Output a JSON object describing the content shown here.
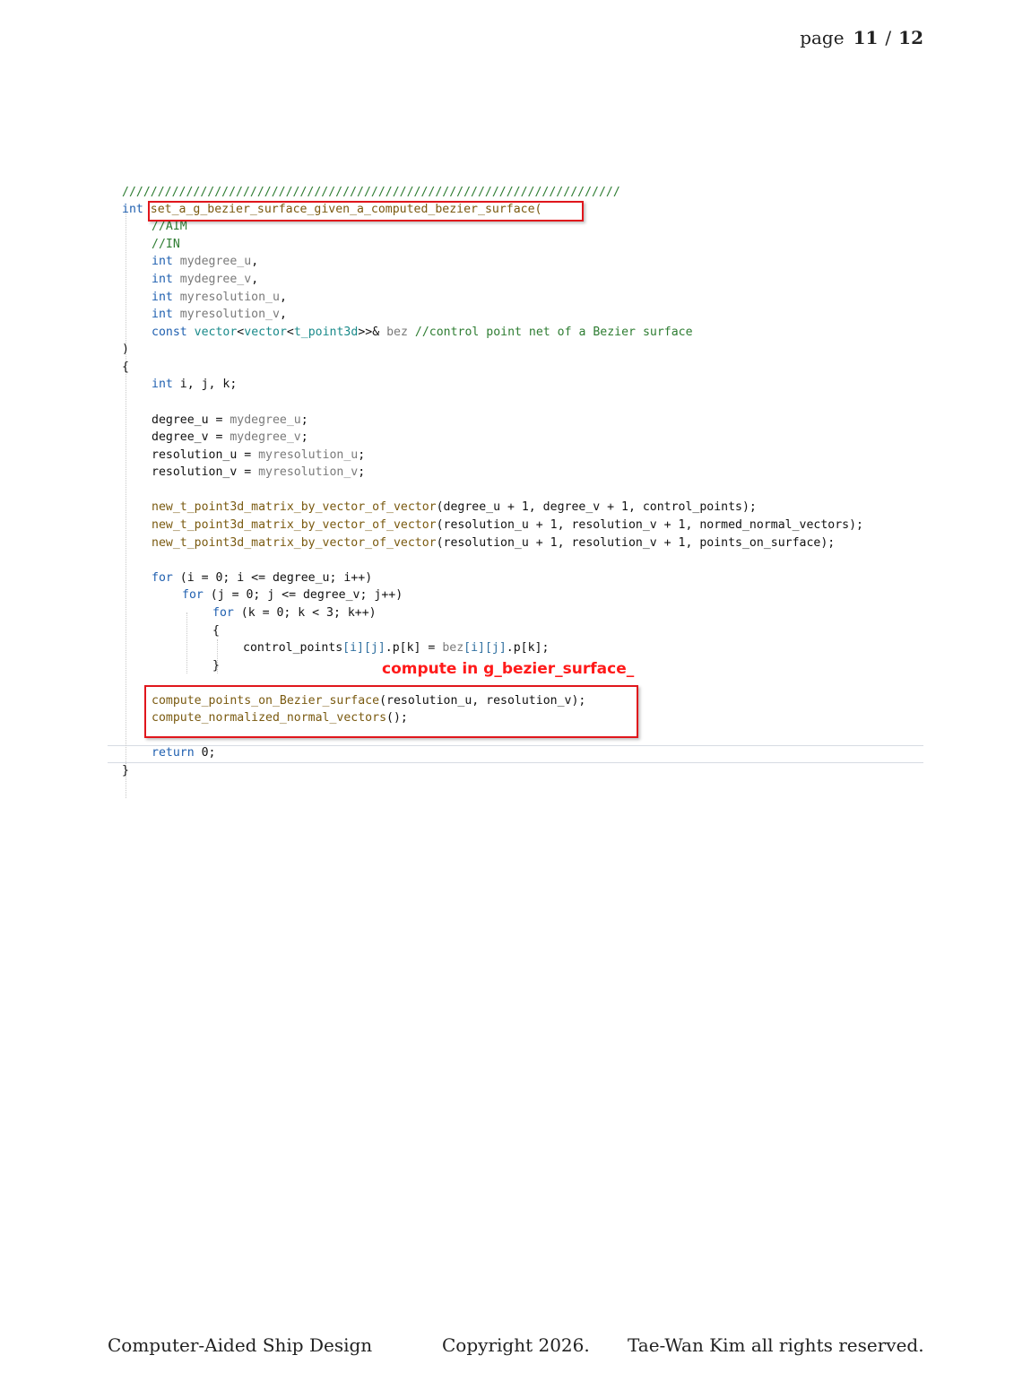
{
  "page_header": {
    "prefix": "page",
    "current": "11",
    "separator": "/",
    "total": "12"
  },
  "code": {
    "banner": "//////////////////////////////////////////////////////////////////////",
    "sig_kw": "int",
    "sig_fn": "set_a_g_bezier_surface_given_a_computed_bezier_surface(",
    "c_aim": "//AIM",
    "c_in": "//IN",
    "params": [
      {
        "kw": "int",
        "name": "mydegree_u",
        "end": ","
      },
      {
        "kw": "int",
        "name": "mydegree_v",
        "end": ","
      },
      {
        "kw": "int",
        "name": "myresolution_u",
        "end": ","
      },
      {
        "kw": "int",
        "name": "myresolution_v",
        "end": ","
      }
    ],
    "p5_const": "const",
    "p5_vec1": "vector",
    "p5_lt1": "<",
    "p5_vec2": "vector",
    "p5_lt2": "<",
    "p5_type": "t_point3d",
    "p5_gt": ">>&",
    "p5_name": "bez",
    "p5_comment": "//control point net of a Bezier surface",
    "close_paren": ")",
    "open_brace": "{",
    "decl_kw": "int",
    "decl_rest": " i, j, k;",
    "assign": [
      {
        "lhs": "degree_u = ",
        "rhs": "mydegree_u",
        "end": ";"
      },
      {
        "lhs": "degree_v = ",
        "rhs": "mydegree_v",
        "end": ";"
      },
      {
        "lhs": "resolution_u = ",
        "rhs": "myresolution_u",
        "end": ";"
      },
      {
        "lhs": "resolution_v = ",
        "rhs": "myresolution_v",
        "end": ";"
      }
    ],
    "calls": [
      {
        "fn": "new_t_point3d_matrix_by_vector_of_vector",
        "args": "(degree_u + 1, degree_v + 1, control_points);"
      },
      {
        "fn": "new_t_point3d_matrix_by_vector_of_vector",
        "args": "(resolution_u + 1, resolution_v + 1, normed_normal_vectors);"
      },
      {
        "fn": "new_t_point3d_matrix_by_vector_of_vector",
        "args": "(resolution_u + 1, resolution_v + 1, points_on_surface);"
      }
    ],
    "for1_kw": "for",
    "for1_rest": " (i = 0; i <= degree_u; i++)",
    "for2_kw": "for",
    "for2_rest": " (j = 0; j <= degree_v; j++)",
    "for3_kw": "for",
    "for3_rest": " (k = 0; k < 3; k++)",
    "inner_open": "{",
    "body_lhs": "control_points",
    "body_idx1": "[i][j]",
    "body_mid": ".p[k] = ",
    "body_bez": "bez",
    "body_idx2": "[i][j]",
    "body_end": ".p[k];",
    "inner_close": "}",
    "compute1_fn": "compute_points_on_Bezier_surface",
    "compute1_args": "(resolution_u, resolution_v);",
    "compute2_fn": "compute_normalized_normal_vectors",
    "compute2_args": "();",
    "ret_kw": "return",
    "ret_rest": " 0;",
    "close_brace": "}"
  },
  "annotation": "compute in g_bezier_surface_",
  "footer": {
    "left": "Computer-Aided Ship Design",
    "center": "Copyright 2026.",
    "right": "Tae-Wan Kim all rights reserved."
  },
  "colors": {
    "keyword": "#2060b0",
    "comment": "#2e7d32",
    "function": "#7a5a10",
    "param": "#7a7a7a",
    "highlight_box": "#e0161c",
    "annotation": "#ff1a1a"
  }
}
